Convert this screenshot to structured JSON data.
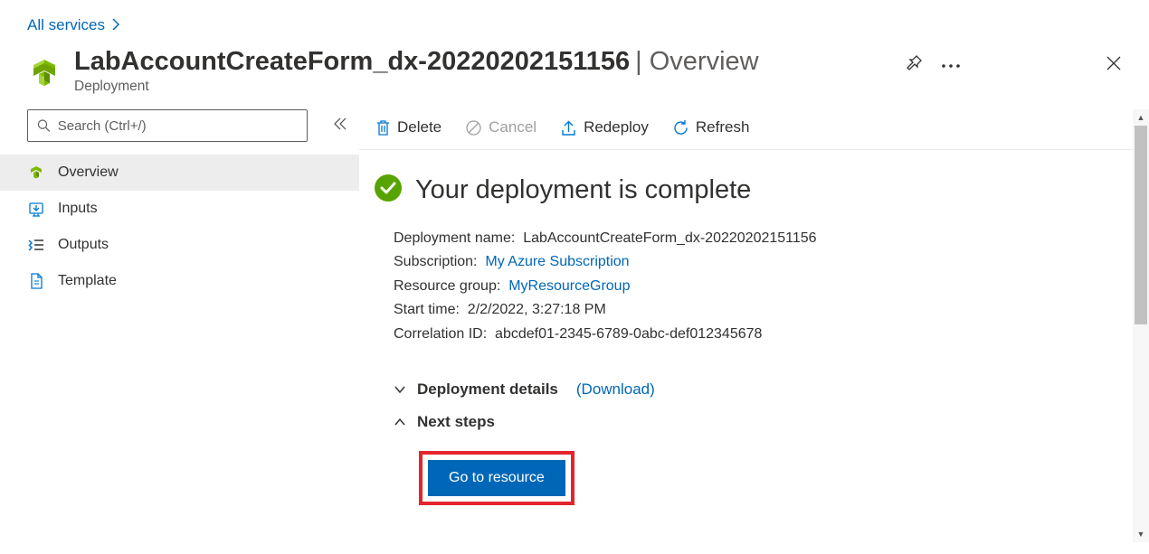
{
  "breadcrumb": {
    "root": "All services"
  },
  "header": {
    "title_main": "LabAccountCreateForm_dx-20220202151156",
    "title_suffix": " | Overview",
    "subtitle": "Deployment"
  },
  "search": {
    "placeholder": "Search (Ctrl+/)"
  },
  "sidebar": {
    "items": [
      {
        "label": "Overview"
      },
      {
        "label": "Inputs"
      },
      {
        "label": "Outputs"
      },
      {
        "label": "Template"
      }
    ]
  },
  "toolbar": {
    "delete_label": "Delete",
    "cancel_label": "Cancel",
    "redeploy_label": "Redeploy",
    "refresh_label": "Refresh"
  },
  "deployment": {
    "status_title": "Your deployment is complete",
    "details": {
      "deployment_name_label": "Deployment name:  ",
      "deployment_name": "LabAccountCreateForm_dx-20220202151156",
      "subscription_label": "Subscription:  ",
      "subscription": "My Azure Subscription",
      "resource_group_label": "Resource group:  ",
      "resource_group": "MyResourceGroup",
      "start_time_label": "Start time:  ",
      "start_time": "2/2/2022, 3:27:18 PM",
      "correlation_id_label": "Correlation ID:  ",
      "correlation_id": "abcdef01-2345-6789-0abc-def012345678"
    },
    "sections": {
      "deployment_details": "Deployment details",
      "download": "(Download)",
      "next_steps": "Next steps"
    },
    "go_to_resource": "Go to resource"
  }
}
